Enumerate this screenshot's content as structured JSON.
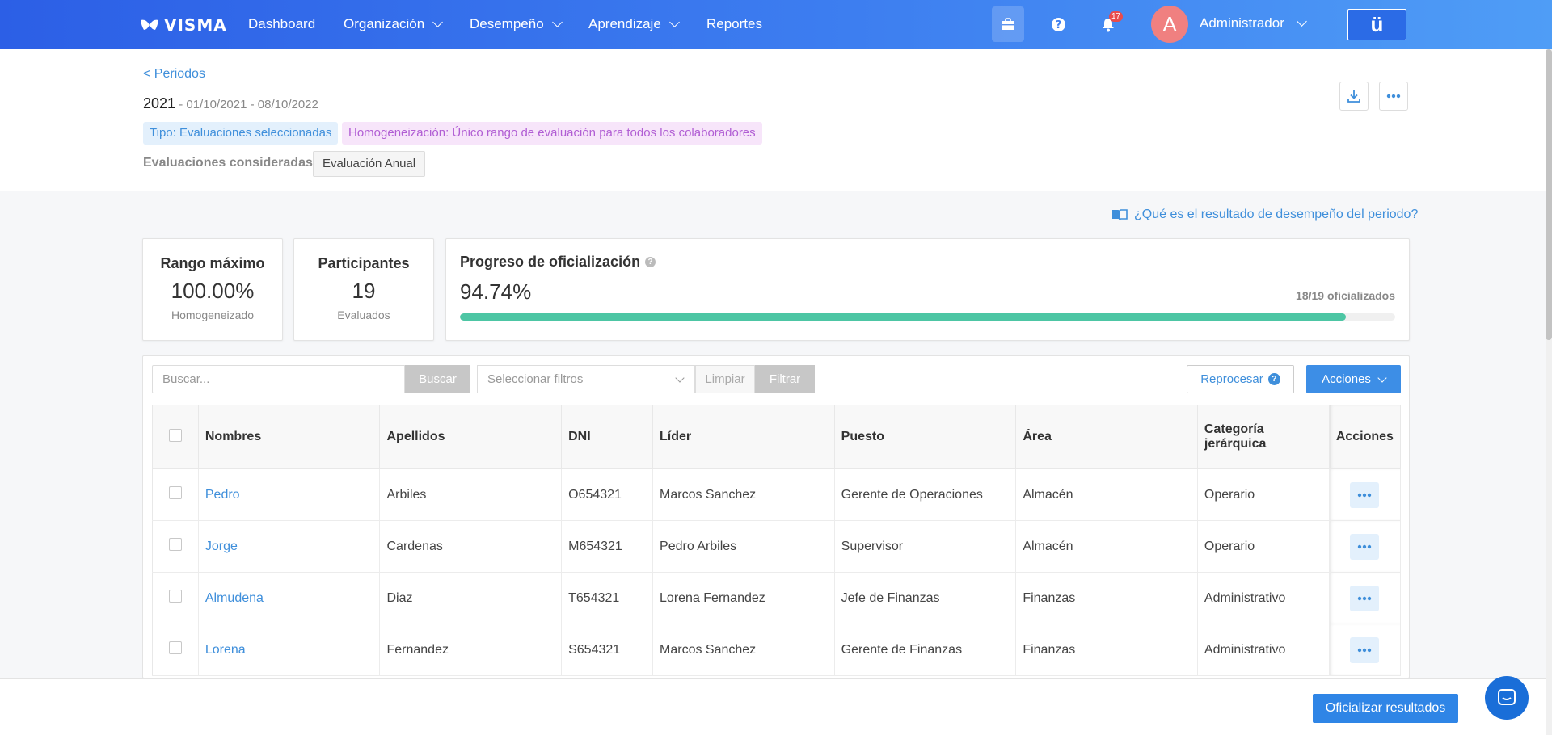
{
  "nav": {
    "brand": "VISMA",
    "items": [
      {
        "label": "Dashboard",
        "dropdown": false
      },
      {
        "label": "Organización",
        "dropdown": true
      },
      {
        "label": "Desempeño",
        "dropdown": true
      },
      {
        "label": "Aprendizaje",
        "dropdown": true
      },
      {
        "label": "Reportes",
        "dropdown": false
      }
    ],
    "notifications_count": "17",
    "avatar_initial": "A",
    "user_name": "Administrador",
    "brand_button": "ü"
  },
  "header": {
    "back_link": "< Periodos",
    "year": "2021",
    "dates": " - 01/10/2021 - 08/10/2022",
    "tag_type": "Tipo: Evaluaciones seleccionadas",
    "tag_homog": "Homogeneización: Único rango de evaluación para todos los colaboradores",
    "evaluations_label": "Evaluaciones consideradas:",
    "evaluation_chip": "Evaluación Anual"
  },
  "help_link": "¿Qué es el resultado de desempeño del periodo?",
  "stats": {
    "max_range": {
      "title": "Rango máximo",
      "value": "100.00%",
      "sub": "Homogeneizado"
    },
    "participants": {
      "title": "Participantes",
      "value": "19",
      "sub": "Evaluados"
    },
    "progress": {
      "title": "Progreso de oficialización",
      "value": "94.74%",
      "count": "18/19 oficializados",
      "fraction": 0.9474
    }
  },
  "toolbar": {
    "search_placeholder": "Buscar...",
    "search_button": "Buscar",
    "filter_placeholder": "Seleccionar filtros",
    "clear_button": "Limpiar",
    "filter_button": "Filtrar",
    "reprocess_button": "Reprocesar",
    "actions_button": "Acciones"
  },
  "table": {
    "columns": [
      "Nombres",
      "Apellidos",
      "DNI",
      "Líder",
      "Puesto",
      "Área",
      "Categoría jerárquica",
      "Acciones"
    ],
    "rows": [
      {
        "nombre": "Pedro",
        "apellido": "Arbiles",
        "dni": "O654321",
        "lider": "Marcos Sanchez",
        "puesto": "Gerente de Operaciones",
        "area": "Almacén",
        "categoria": "Operario"
      },
      {
        "nombre": "Jorge",
        "apellido": "Cardenas",
        "dni": "M654321",
        "lider": "Pedro Arbiles",
        "puesto": "Supervisor",
        "area": "Almacén",
        "categoria": "Operario"
      },
      {
        "nombre": "Almudena",
        "apellido": "Diaz",
        "dni": "T654321",
        "lider": "Lorena Fernandez",
        "puesto": "Jefe de Finanzas",
        "area": "Finanzas",
        "categoria": "Administrativo"
      },
      {
        "nombre": "Lorena",
        "apellido": "Fernandez",
        "dni": "S654321",
        "lider": "Marcos Sanchez",
        "puesto": "Gerente de Finanzas",
        "area": "Finanzas",
        "categoria": "Administrativo"
      }
    ]
  },
  "footer": {
    "officialize_button": "Oficializar resultados"
  },
  "colors": {
    "accent": "#3d8ee6",
    "progress": "#4dc6a4",
    "link": "#3f8fdb"
  }
}
